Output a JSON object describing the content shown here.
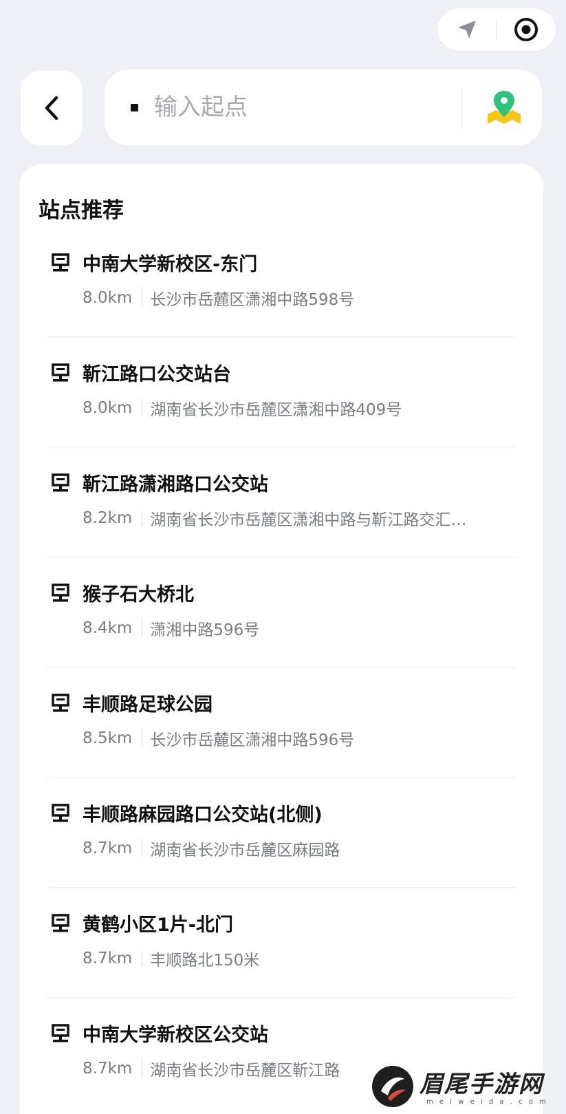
{
  "header": {
    "locate_icon": "navigation-arrow-icon",
    "target_icon": "target-icon"
  },
  "search": {
    "back_icon": "chevron-left-icon",
    "placeholder": "输入起点",
    "value": "",
    "map_icon": "map-pin-icon",
    "colors": {
      "pin": "#2ec27e",
      "map": "#f5c518"
    }
  },
  "recommend": {
    "title": "站点推荐",
    "station_icon": "bus-stop-icon",
    "stations": [
      {
        "name": "中南大学新校区-东门",
        "distance": "8.0km",
        "address": "长沙市岳麓区潇湘中路598号"
      },
      {
        "name": "靳江路口公交站台",
        "distance": "8.0km",
        "address": "湖南省长沙市岳麓区潇湘中路409号"
      },
      {
        "name": "靳江路潇湘路口公交站",
        "distance": "8.2km",
        "address": "湖南省长沙市岳麓区潇湘中路与靳江路交汇…"
      },
      {
        "name": "猴子石大桥北",
        "distance": "8.4km",
        "address": "潇湘中路596号"
      },
      {
        "name": "丰顺路足球公园",
        "distance": "8.5km",
        "address": "长沙市岳麓区潇湘中路596号"
      },
      {
        "name": "丰顺路麻园路口公交站(北侧)",
        "distance": "8.7km",
        "address": "湖南省长沙市岳麓区麻园路"
      },
      {
        "name": "黄鹤小区1片-北门",
        "distance": "8.7km",
        "address": "丰顺路北150米"
      },
      {
        "name": "中南大学新校区公交站",
        "distance": "8.7km",
        "address": "湖南省长沙市岳麓区靳江路"
      }
    ]
  },
  "watermark": {
    "text": "眉尾手游网",
    "url": "m e i w e i d a . c o m"
  }
}
